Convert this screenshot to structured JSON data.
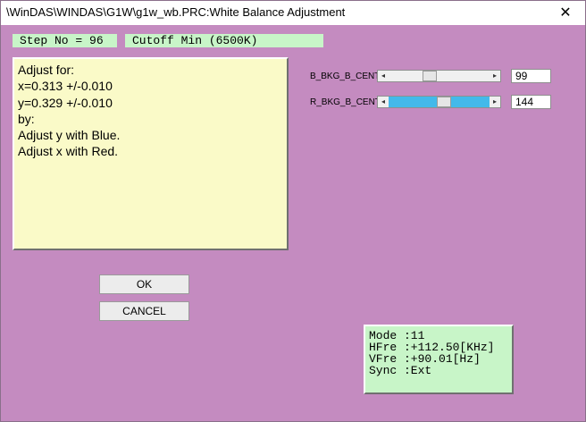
{
  "window": {
    "title": "\\WinDAS\\WINDAS\\G1W\\g1w_wb.PRC:White Balance Adjustment",
    "close_glyph": "✕",
    "background": "#C48BC0"
  },
  "step": {
    "label": "Step No =  96",
    "name": "Cutoff Min (6500K)"
  },
  "instructions": [
    "Adjust for:",
    "x=0.313 +/-0.010",
    "y=0.329 +/-0.010",
    "by:",
    "Adjust y with Blue.",
    "Adjust x with Red."
  ],
  "sliders": [
    {
      "label": "B_BKG_B_CENT",
      "value": "99",
      "left_arrow": "◂",
      "right_arrow": "▸",
      "level": 0.39
    },
    {
      "label": "R_BKG_B_CENT",
      "value": "144",
      "left_arrow": "◂",
      "right_arrow": "▸",
      "level": 0.56
    }
  ],
  "buttons": {
    "ok": "OK",
    "cancel": "CANCEL"
  },
  "info": {
    "mode": "Mode :11",
    "hfre": "HFre :+112.50[KHz]",
    "vfre": "VFre :+90.01[Hz]",
    "sync": "Sync :Ext"
  },
  "colors": {
    "panel_yellow": "#FAFAC8",
    "panel_green": "#C8F5C8",
    "slider_fill": "#43B9EA"
  }
}
